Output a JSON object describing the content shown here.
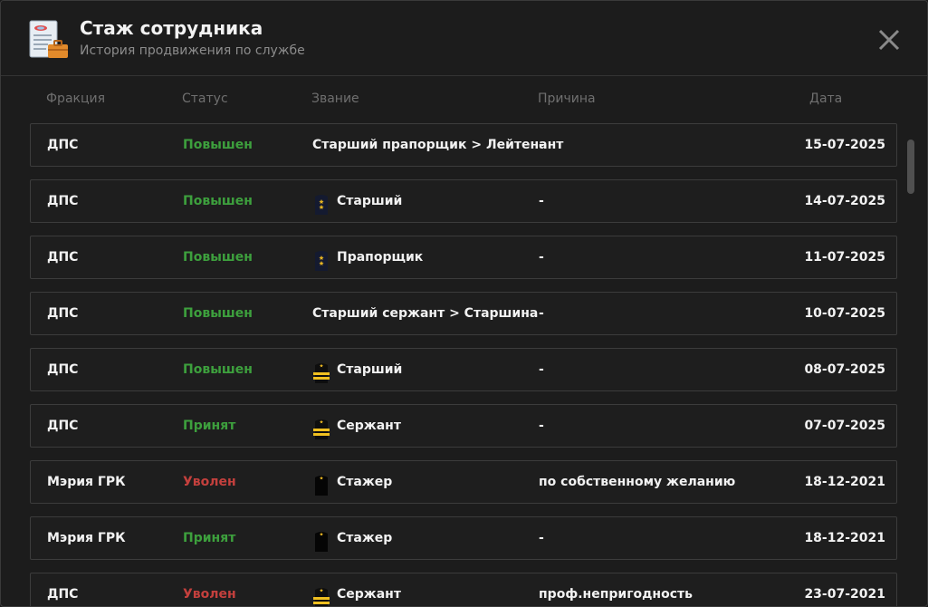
{
  "header": {
    "title": "Стаж сотрудника",
    "subtitle": "История продвижения по службе",
    "icon": "document-briefcase-icon",
    "close_icon": "close-icon"
  },
  "columns": {
    "faction": "Фракция",
    "status": "Статус",
    "rank": "Звание",
    "reason": "Причина",
    "date": "Дата"
  },
  "colors": {
    "promoted": "#3da03d",
    "hired": "#3da03d",
    "fired": "#c4403d"
  },
  "rows": [
    {
      "faction": "ДПС",
      "status": "Повышен",
      "status_color": "green",
      "rank": "Старший прапорщик > Лейтенант",
      "rank_icon": "none",
      "reason": "-",
      "date": "15-07-2025"
    },
    {
      "faction": "ДПС",
      "status": "Повышен",
      "status_color": "green",
      "rank": "Старший",
      "rank_icon": "epaulette-navy-stars",
      "reason": "-",
      "date": "14-07-2025"
    },
    {
      "faction": "ДПС",
      "status": "Повышен",
      "status_color": "green",
      "rank": "Прапорщик",
      "rank_icon": "epaulette-navy-stars",
      "reason": "-",
      "date": "11-07-2025"
    },
    {
      "faction": "ДПС",
      "status": "Повышен",
      "status_color": "green",
      "rank": "Старший сержант > Старшина",
      "rank_icon": "none",
      "reason": "-",
      "date": "10-07-2025"
    },
    {
      "faction": "ДПС",
      "status": "Повышен",
      "status_color": "green",
      "rank": "Старший",
      "rank_icon": "epaulette-gold-stripes",
      "reason": "-",
      "date": "08-07-2025"
    },
    {
      "faction": "ДПС",
      "status": "Принят",
      "status_color": "green",
      "rank": "Сержант",
      "rank_icon": "epaulette-gold-stripes",
      "reason": "-",
      "date": "07-07-2025"
    },
    {
      "faction": "Мэрия ГРК",
      "status": "Уволен",
      "status_color": "red",
      "rank": "Стажер",
      "rank_icon": "epaulette-black",
      "reason": "по собственному желанию",
      "date": "18-12-2021"
    },
    {
      "faction": "Мэрия ГРК",
      "status": "Принят",
      "status_color": "green",
      "rank": "Стажер",
      "rank_icon": "epaulette-black",
      "reason": "-",
      "date": "18-12-2021"
    },
    {
      "faction": "ДПС",
      "status": "Уволен",
      "status_color": "red",
      "rank": "Сержант",
      "rank_icon": "epaulette-gold-stripes",
      "reason": "проф.непригодность",
      "date": "23-07-2021"
    }
  ]
}
